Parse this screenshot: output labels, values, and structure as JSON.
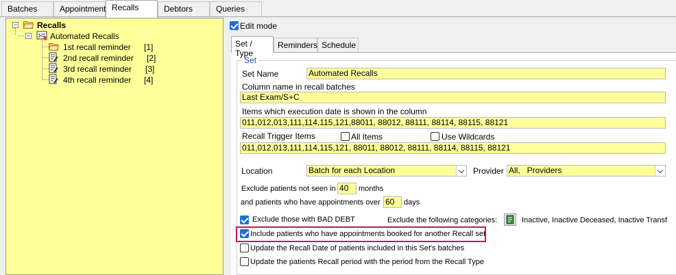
{
  "top_tabs": [
    "Batches",
    "Appointments",
    "Recalls",
    "Debtors",
    "Queries"
  ],
  "active_top_tab": "Recalls",
  "tree": {
    "root": "Recalls",
    "child": "Automated Recalls",
    "leaves": [
      {
        "label": "1st recall reminder",
        "index": "[1]"
      },
      {
        "label": "2nd recall reminder",
        "index": "[2]"
      },
      {
        "label": "3rd recall reminder",
        "index": "[3]"
      },
      {
        "label": "4th recall reminder",
        "index": "[4]"
      }
    ]
  },
  "edit_mode": {
    "label": "Edit mode",
    "checked": true
  },
  "sub_tabs": [
    "Set / Type",
    "Reminders",
    "Schedule"
  ],
  "active_sub_tab": "Set / Type",
  "set_group": {
    "legend": "Set",
    "set_name_label": "Set Name",
    "set_name_value": "Automated Recalls",
    "column_name_label": "Column name in recall batches",
    "column_name_value": "Last Exam/S+C",
    "items_label": "Items which execution date is shown in the column",
    "items_value": "011,012,013,111,114,115,121,88011, 88012, 88111, 88114, 88115, 88121",
    "trigger_label": "Recall Trigger Items",
    "all_items_label": "All Items",
    "use_wildcards_label": "Use Wildcards",
    "trigger_value": "011,012,013,111,114,115,121, 88011, 88012, 88111, 88114, 88115, 88121",
    "location_label": "Location",
    "location_value": "Batch for each Location",
    "provider_label": "Provider",
    "provider_value": "All,   Providers",
    "exclude_not_seen_label": "Exclude patients not seen in",
    "exclude_not_seen_value": "40",
    "months_label": "months",
    "appointments_over_label": "and patients who have appointments over",
    "appointments_over_value": "60",
    "days_label": "days",
    "bad_debt_label": "Exclude those with BAD DEBT",
    "exclude_categories_label": "Exclude the following categories:",
    "exclude_categories_value": "Inactive, Inactive Deceased, Inactive Transfe",
    "include_booked_label": "Include patients who have appointments booked for another Recall set",
    "update_recall_date_label": "Update the Recall Date of patients included in this Set's batches",
    "update_period_label": "Update the patients Recall period with the period from the Recall Type"
  }
}
